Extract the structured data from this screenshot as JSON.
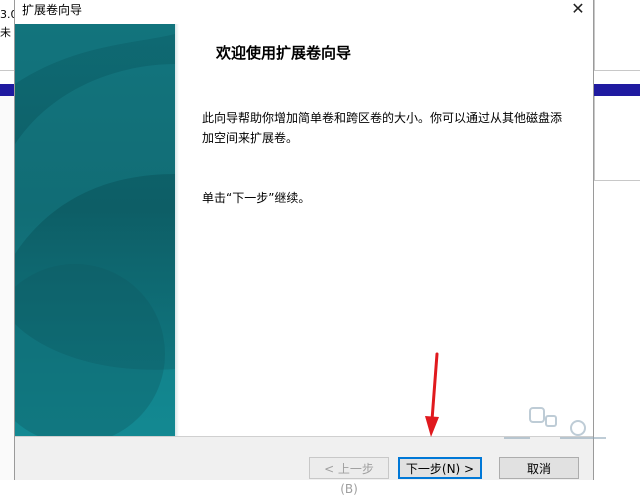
{
  "background": {
    "text_line_1": "3.0",
    "text_line_2": "未"
  },
  "dialog": {
    "title": "扩展卷向导",
    "close_glyph": "✕",
    "heading": "欢迎使用扩展卷向导",
    "description": "此向导帮助你增加简单卷和跨区卷的大小。你可以通过从其他磁盘添加空间来扩展卷。",
    "continue_hint": "单击“下一步”继续。",
    "buttons": {
      "back": "< 上一步(B)",
      "next": "下一步(N) >",
      "cancel": "取消"
    }
  },
  "annotation": {
    "arrow_color": "#e0191e"
  },
  "colors": {
    "art_teal": "#0f6a73",
    "accent": "#0078d7",
    "background_bar": "#1f1aa0"
  }
}
